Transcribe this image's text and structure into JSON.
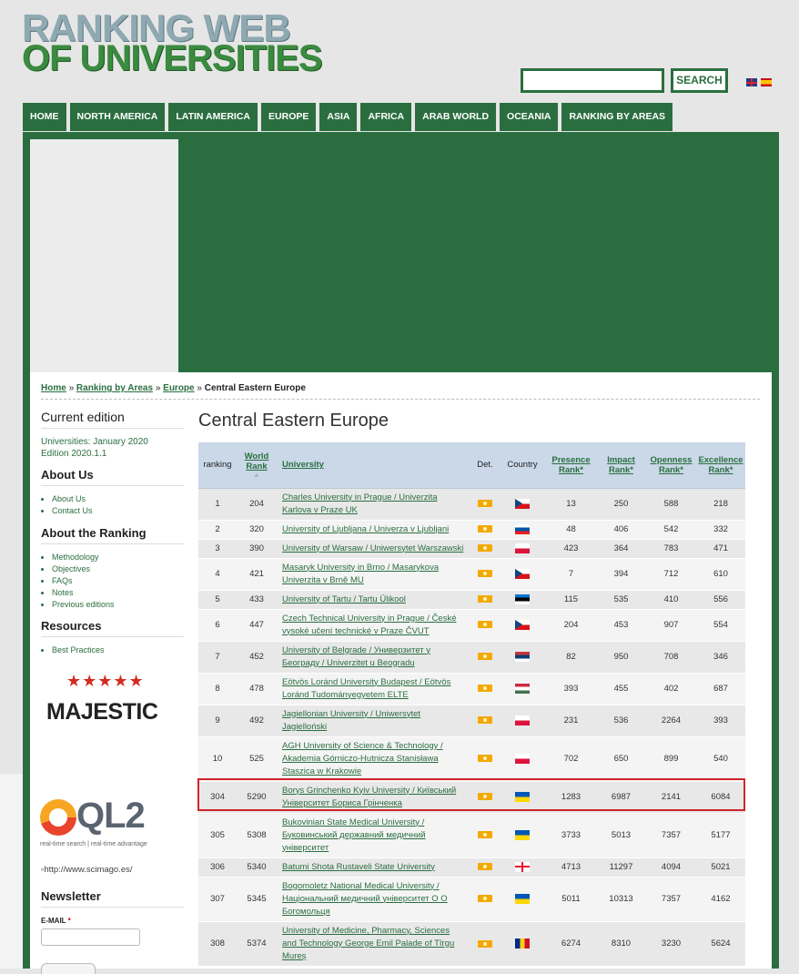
{
  "logo": {
    "line1": "RANKING WEB",
    "line2": "OF UNIVERSITIES"
  },
  "search": {
    "placeholder": "",
    "button_label": "SEARCH"
  },
  "nav": [
    "HOME",
    "NORTH AMERICA",
    "LATIN AMERICA",
    "EUROPE",
    "ASIA",
    "AFRICA",
    "ARAB WORLD",
    "OCEANIA",
    "RANKING BY AREAS"
  ],
  "breadcrumb": {
    "home": "Home",
    "sep": "»",
    "areas": "Ranking by Areas",
    "europe": "Europe",
    "current": "Central Eastern Europe"
  },
  "sidebar": {
    "current_edition_title": "Current edition",
    "edition_line1": "Universities: January 2020",
    "edition_line2": "Edition 2020.1.1",
    "about_us_title": "About Us",
    "about_us_items": [
      "About Us",
      "Contact Us"
    ],
    "about_ranking_title": "About the Ranking",
    "about_ranking_items": [
      "Methodology",
      "Objectives",
      "FAQs",
      "Notes",
      "Previous editions"
    ],
    "resources_title": "Resources",
    "resources_items": [
      "Best Practices"
    ],
    "majestic_logo": "MAJESTIC",
    "ql2_logo": "QL2",
    "ql2_tagline": "real-time search | real-time advantage",
    "scimago_alt": "http://www.scimago.es/",
    "newsletter_title": "Newsletter",
    "email_label": "E-MAIL",
    "email_required": "*"
  },
  "main": {
    "title": "Central Eastern Europe"
  },
  "table": {
    "headers": {
      "ranking": "ranking",
      "world_rank_1": "World",
      "world_rank_2": "Rank",
      "university": "University",
      "det": "Det.",
      "country": "Country",
      "presence_1": "Presence",
      "presence_2": "Rank*",
      "impact_1": "Impact",
      "impact_2": "Rank*",
      "openness_1": "Openness",
      "openness_2": "Rank*",
      "excellence_1": "Excellence",
      "excellence_2": "Rank*"
    },
    "rows": [
      {
        "ranking": "1",
        "world": "204",
        "uni1": "Charles University in Prague / Univerzita",
        "uni2": "Karlova v Praze UK",
        "country": "cz",
        "presence": "13",
        "impact": "250",
        "openness": "588",
        "excellence": "218"
      },
      {
        "ranking": "2",
        "world": "320",
        "uni1": "University of Ljubljana / Univerza v Ljubljani",
        "uni2": "",
        "country": "si",
        "presence": "48",
        "impact": "406",
        "openness": "542",
        "excellence": "332"
      },
      {
        "ranking": "3",
        "world": "390",
        "uni1": "University of Warsaw / Uniwersytet Warszawski",
        "uni2": "",
        "country": "pl",
        "presence": "423",
        "impact": "364",
        "openness": "783",
        "excellence": "471"
      },
      {
        "ranking": "4",
        "world": "421",
        "uni1": "Masaryk University in Brno / Masarykova",
        "uni2": "Univerzita v Brně MU",
        "country": "cz",
        "presence": "7",
        "impact": "394",
        "openness": "712",
        "excellence": "610"
      },
      {
        "ranking": "5",
        "world": "433",
        "uni1": "University of Tartu / Tartu Ülikool",
        "uni2": "",
        "country": "ee",
        "presence": "115",
        "impact": "535",
        "openness": "410",
        "excellence": "556"
      },
      {
        "ranking": "6",
        "world": "447",
        "uni1": "Czech Technical University in Prague / České",
        "uni2": "vysoké učení technické v Praze ČVUT",
        "country": "cz",
        "presence": "204",
        "impact": "453",
        "openness": "907",
        "excellence": "554"
      },
      {
        "ranking": "7",
        "world": "452",
        "uni1": "University of Belgrade / Универзитет у",
        "uni2": "Београду / Univerzitet u Beogradu",
        "country": "rs",
        "presence": "82",
        "impact": "950",
        "openness": "708",
        "excellence": "346"
      },
      {
        "ranking": "8",
        "world": "478",
        "uni1": "Eötvös Loránd University Budapest / Eötvös",
        "uni2": "Loránd Tudományegyetem ELTE",
        "country": "hu",
        "presence": "393",
        "impact": "455",
        "openness": "402",
        "excellence": "687"
      },
      {
        "ranking": "9",
        "world": "492",
        "uni1": "Jagiellonian University / Uniwersytet",
        "uni2": "Jagielloński",
        "country": "pl",
        "presence": "231",
        "impact": "536",
        "openness": "2264",
        "excellence": "393"
      },
      {
        "ranking": "10",
        "world": "525",
        "uni1": "AGH University of Science & Technology /",
        "uni2": "Akademia Górniczo-Hutnicza Stanisława",
        "uni3": "Staszica w Krakowie",
        "country": "pl",
        "presence": "702",
        "impact": "650",
        "openness": "899",
        "excellence": "540"
      },
      {
        "ranking": "304",
        "world": "5290",
        "uni1": "Borys Grinchenko Kyiv University / Київський",
        "uni2": "Університет Бориса Грінченка",
        "country": "ua",
        "presence": "1283",
        "impact": "6987",
        "openness": "2141",
        "excellence": "6084"
      },
      {
        "ranking": "305",
        "world": "5308",
        "uni1": "Bukovinian State Medical University /",
        "uni2": "Буковинський державний медичний",
        "uni3": "університет",
        "country": "ua",
        "presence": "3733",
        "impact": "5013",
        "openness": "7357",
        "excellence": "5177"
      },
      {
        "ranking": "306",
        "world": "5340",
        "uni1": "Batumi Shota Rustaveli State University",
        "uni2": "",
        "country": "ge",
        "presence": "4713",
        "impact": "11297",
        "openness": "4094",
        "excellence": "5021"
      },
      {
        "ranking": "307",
        "world": "5345",
        "uni1": "Bogomoletz National Medical University /",
        "uni2": "Національний медичний університет О О",
        "uni3": "Богомольця",
        "country": "ua",
        "presence": "5011",
        "impact": "10313",
        "openness": "7357",
        "excellence": "4162"
      },
      {
        "ranking": "308",
        "world": "5374",
        "uni1": "University of Medicine, Pharmacy, Sciences",
        "uni2": "and Technology George Emil Palade of Tîrgu",
        "uni3": "Mureș",
        "country": "ro",
        "presence": "6274",
        "impact": "8310",
        "openness": "3230",
        "excellence": "5624"
      }
    ]
  },
  "colors": {
    "brand_green": "#2a6e3f",
    "header_blue": "#cad8e8",
    "highlight_red": "#d1232a"
  }
}
